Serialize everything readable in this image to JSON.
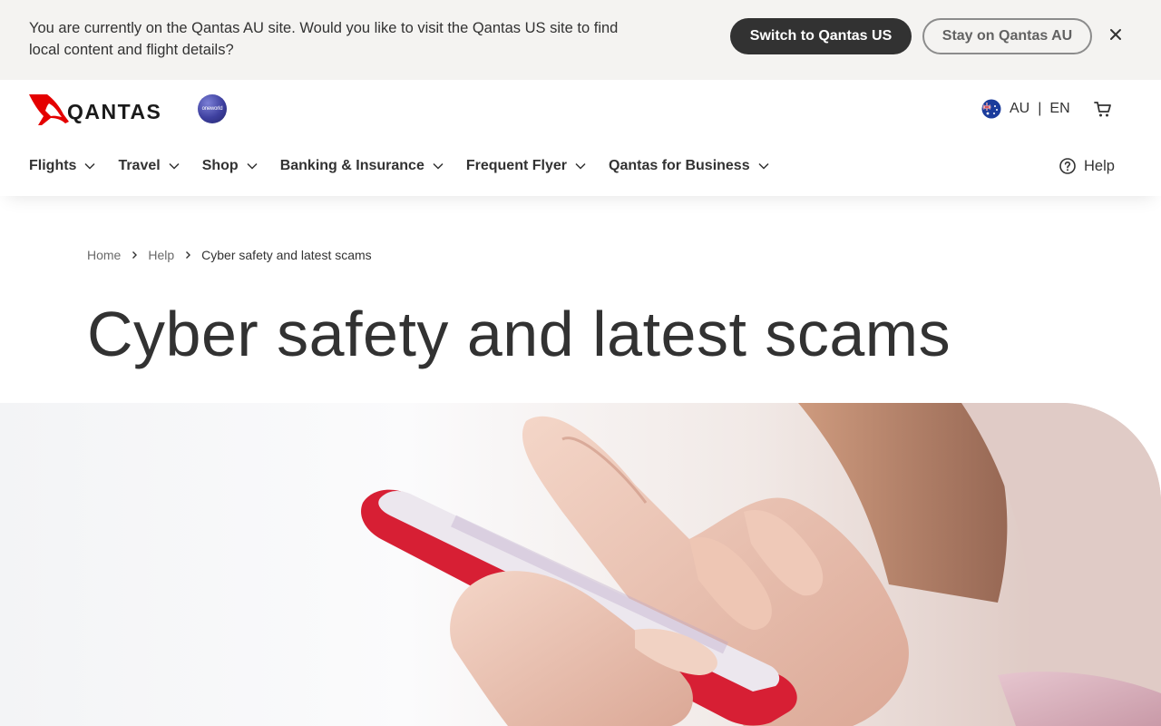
{
  "banner": {
    "message": "You are currently on the Qantas AU site. Would you like to visit the Qantas US site to find local content and flight details?",
    "switch_label": "Switch to Qantas US",
    "stay_label": "Stay on Qantas AU",
    "close_icon": "close-icon"
  },
  "header": {
    "logo_text": "QANTAS",
    "alliance_text": "oneworld",
    "locale": {
      "country": "AU",
      "separator": "|",
      "language": "EN",
      "flag_icon": "australia-flag-icon"
    },
    "cart_icon": "cart-icon",
    "nav": [
      {
        "label": "Flights"
      },
      {
        "label": "Travel"
      },
      {
        "label": "Shop"
      },
      {
        "label": "Banking & Insurance"
      },
      {
        "label": "Frequent Flyer"
      },
      {
        "label": "Qantas for Business"
      }
    ],
    "help_label": "Help"
  },
  "breadcrumb": {
    "items": [
      "Home",
      "Help"
    ],
    "current": "Cyber safety and latest scams"
  },
  "page": {
    "title": "Cyber safety and latest scams"
  },
  "colors": {
    "brand_red": "#e40000",
    "text_dark": "#323232",
    "banner_bg": "#f4f3f1"
  }
}
